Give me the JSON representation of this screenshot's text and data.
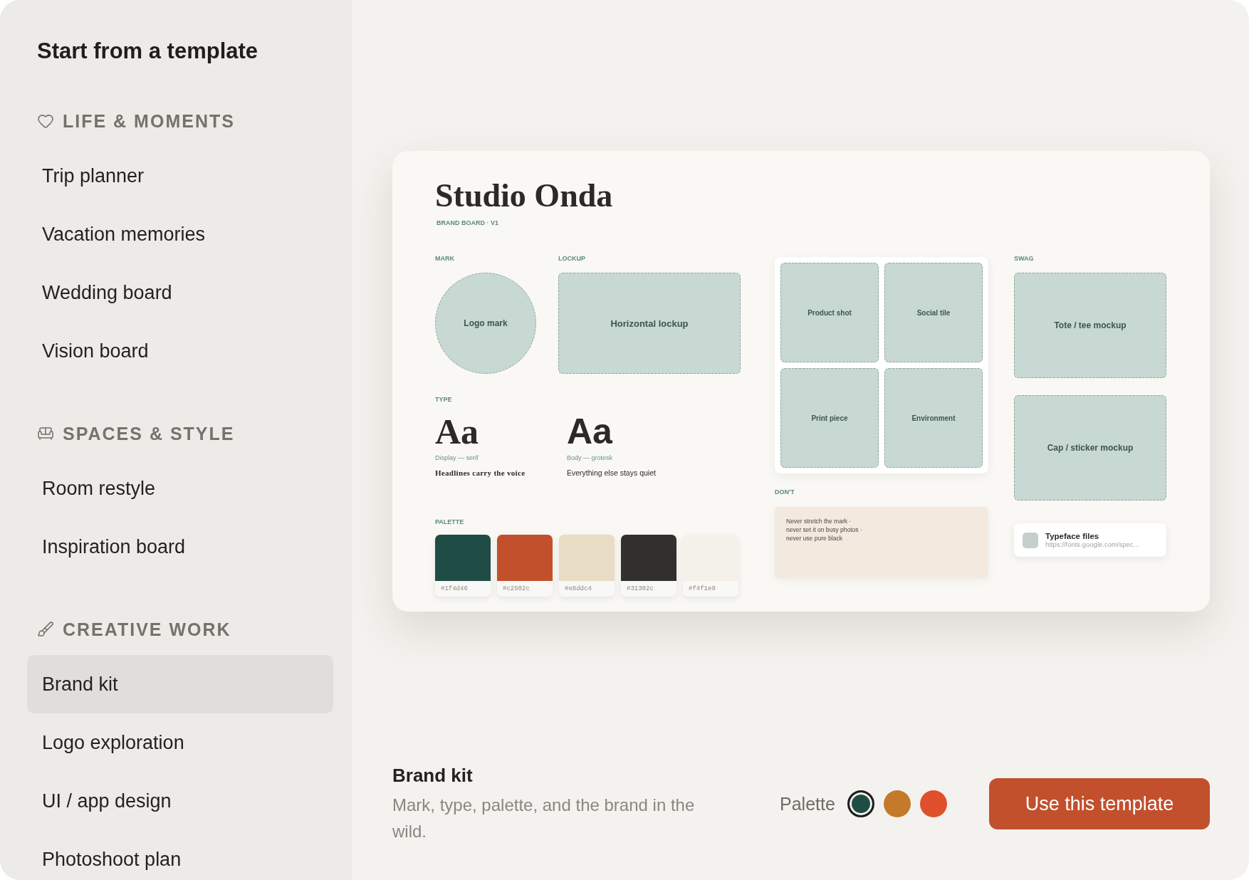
{
  "sidebar": {
    "title": "Start from a template",
    "sections": [
      {
        "label": "LIFE & MOMENTS",
        "items": [
          {
            "label": "Trip planner",
            "selected": false
          },
          {
            "label": "Vacation memories",
            "selected": false
          },
          {
            "label": "Wedding board",
            "selected": false
          },
          {
            "label": "Vision board",
            "selected": false
          }
        ]
      },
      {
        "label": "SPACES & STYLE",
        "items": [
          {
            "label": "Room restyle",
            "selected": false
          },
          {
            "label": "Inspiration board",
            "selected": false
          }
        ]
      },
      {
        "label": "CREATIVE WORK",
        "items": [
          {
            "label": "Brand kit",
            "selected": true
          },
          {
            "label": "Logo exploration",
            "selected": false
          },
          {
            "label": "UI / app design",
            "selected": false
          },
          {
            "label": "Photoshoot plan",
            "selected": false
          }
        ]
      }
    ]
  },
  "board": {
    "title": "Studio Onda",
    "subtitle": "BRAND BOARD · V1",
    "mark": {
      "heading": "MARK",
      "slot": "Logo mark"
    },
    "lockup": {
      "heading": "LOCKUP",
      "slot": "Horizontal lockup"
    },
    "type": {
      "heading": "TYPE",
      "specimens": [
        {
          "kind": "serif",
          "glyphs": "Aa",
          "caption": "Display — serif",
          "sample": "Headlines carry the voice"
        },
        {
          "kind": "sans",
          "glyphs": "Aa",
          "caption": "Body — grotesk",
          "sample": "Everything else stays quiet"
        }
      ]
    },
    "palette": {
      "heading": "PALETTE",
      "swatches": [
        {
          "color": "#1f4d46",
          "code": "#1f4d46"
        },
        {
          "color": "#c2502c",
          "code": "#c2502c"
        },
        {
          "color": "#e8ddc4",
          "code": "#e8ddc4"
        },
        {
          "color": "#31302c",
          "code": "#31302c"
        },
        {
          "color": "#f4f1e9",
          "code": "#f4f1e9"
        }
      ]
    },
    "scenes": [
      "Product shot",
      "Social tile",
      "Print piece",
      "Environment"
    ],
    "dont": {
      "heading": "DON'T",
      "lines": [
        "Never stretch the mark ·",
        "never set it on busy photos ·",
        "never use pure black"
      ]
    },
    "swag": {
      "heading": "SWAG",
      "slots": [
        "Tote / tee mockup",
        "Cap / sticker mockup"
      ]
    },
    "file": {
      "title": "Typeface files",
      "url": "https://fonts.google.com/spec..."
    }
  },
  "footer": {
    "title": "Brand kit",
    "description": "Mark, type, palette, and the brand in the wild.",
    "palette_label": "Palette",
    "palettes": [
      {
        "color": "#1f4d46",
        "selected": true
      },
      {
        "color": "#c47a2a",
        "selected": false
      },
      {
        "color": "#e0502c",
        "selected": false
      }
    ],
    "button": "Use this template"
  }
}
